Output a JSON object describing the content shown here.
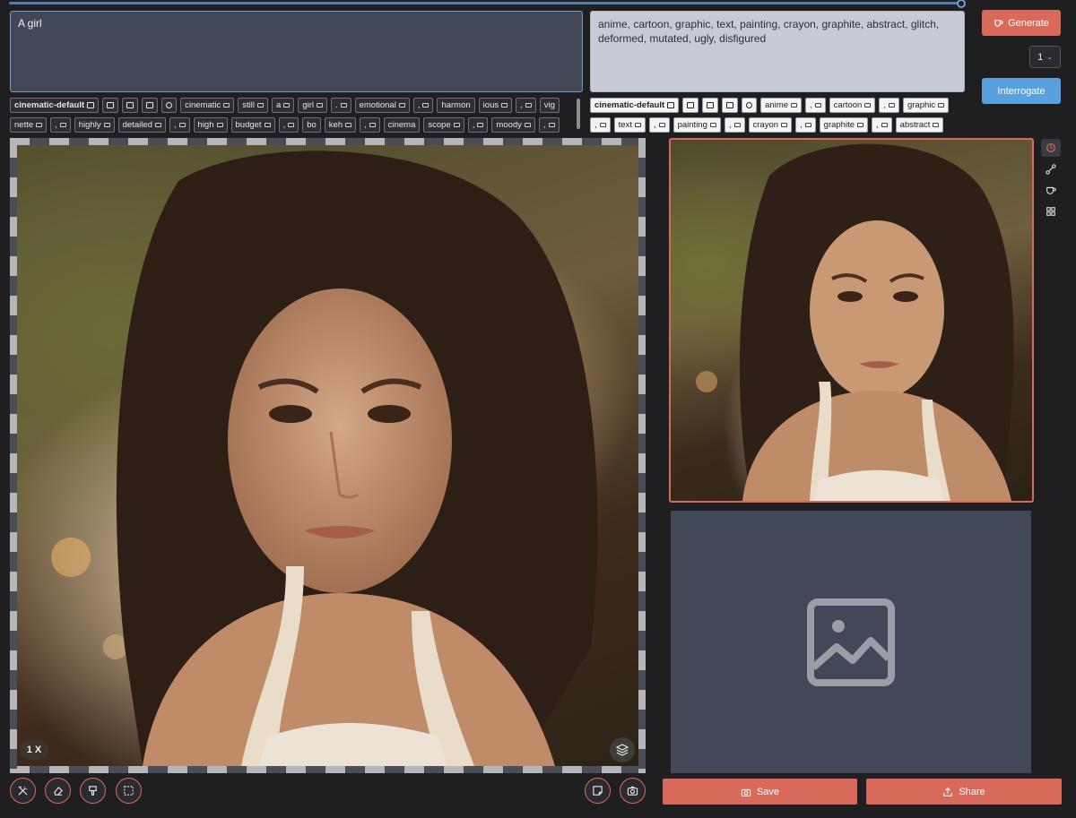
{
  "progress": {
    "value": 1.0
  },
  "prompt": {
    "value": "A girl"
  },
  "negative_prompt": {
    "value": "anime, cartoon, graphic, text, painting, crayon, graphite, abstract, glitch, deformed, mutated, ugly, disfigured"
  },
  "actions": {
    "generate": "Generate",
    "interrogate": "Interrogate",
    "batch_count": "1",
    "save": "Save",
    "share": "Share"
  },
  "positive_tags": {
    "row1": [
      "cinematic-default",
      "cinematic",
      "still",
      "a",
      "girl",
      ".",
      "emotional",
      ",",
      "harmon",
      "ious",
      ",",
      "vig"
    ],
    "row2": [
      "nette",
      ",",
      "highly",
      "detailed",
      ",",
      "high",
      "budget",
      ",",
      "bo",
      "keh",
      ",",
      "cinema",
      "scope",
      ",",
      "moody",
      ","
    ]
  },
  "negative_tags": {
    "row1": [
      "cinematic-default",
      "anime",
      ",",
      "cartoon",
      ",",
      "graphic"
    ],
    "row2": [
      ",",
      "text",
      ",",
      "painting",
      ",",
      "crayon",
      ",",
      "graphite",
      ",",
      "abstract"
    ]
  },
  "canvas": {
    "zoom": "1 X"
  },
  "colors": {
    "accent": "#d96a5b",
    "interrogate": "#5aa0dc",
    "panel": "#424857",
    "background": "#1f1f22"
  }
}
